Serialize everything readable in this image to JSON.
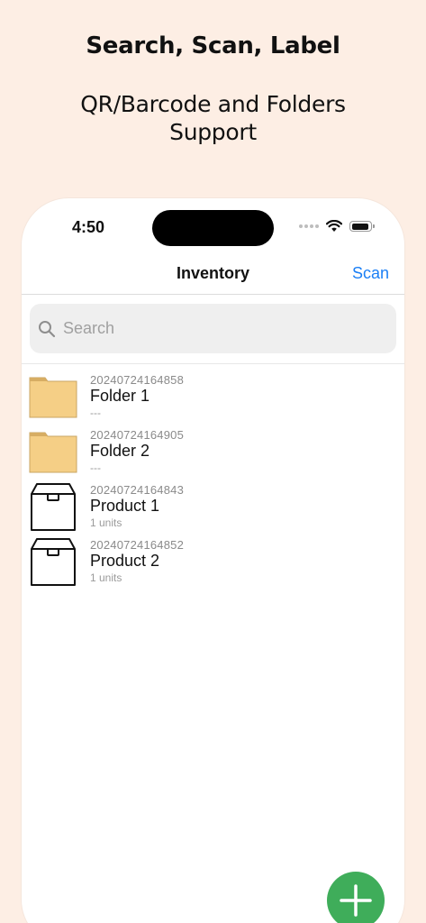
{
  "promo": {
    "headline": "Search, Scan, Label",
    "subline": "QR/Barcode and Folders Support"
  },
  "status_bar": {
    "time": "4:50"
  },
  "nav": {
    "title": "Inventory",
    "scan_label": "Scan"
  },
  "search": {
    "placeholder": "Search",
    "value": ""
  },
  "items": [
    {
      "code": "20240724164858",
      "name": "Folder 1",
      "sub": "---",
      "icon": "folder-icon"
    },
    {
      "code": "20240724164905",
      "name": "Folder 2",
      "sub": "---",
      "icon": "folder-icon"
    },
    {
      "code": "20240724164843",
      "name": "Product 1",
      "sub": "1 units",
      "icon": "box-icon"
    },
    {
      "code": "20240724164852",
      "name": "Product 2",
      "sub": "1 units",
      "icon": "box-icon"
    }
  ],
  "colors": {
    "background": "#fdeee4",
    "accent": "#1b7ff5",
    "fab": "#3fad5a",
    "folder": "#f5cf86"
  }
}
